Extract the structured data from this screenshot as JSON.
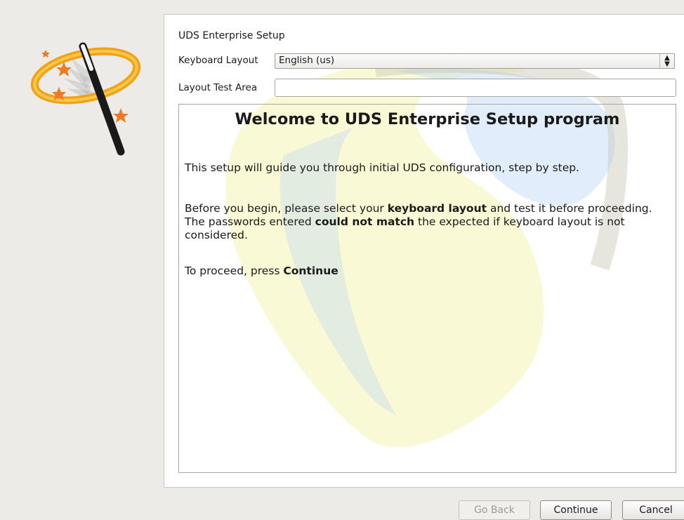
{
  "window": {
    "title": "UDS Enterprise Setup"
  },
  "keyboard": {
    "label": "Keyboard Layout",
    "selected": "English (us)",
    "test_label": "Layout Test Area",
    "test_value": ""
  },
  "welcome": {
    "title": "Welcome to UDS Enterprise Setup program",
    "intro": "This setup will guide you through initial UDS configuration, step by step.",
    "before_1": "Before you begin, please select your ",
    "before_bold_1": "keyboard layout",
    "before_2": " and test it before proceeding. The passwords entered ",
    "before_bold_2": "could not match",
    "before_3": " the expected if keyboard layout is not considered.",
    "proceed_1": "To proceed, press ",
    "proceed_bold": "Continue"
  },
  "buttons": {
    "back": "Go Back",
    "continue": "Continue",
    "cancel": "Cancel"
  },
  "colors": {
    "watermark_yellow": "#f1f19a",
    "watermark_blue": "#bcd8f4",
    "watermark_grey": "#c8c8b8"
  },
  "icons": {
    "logo": "magic-wand-icon",
    "select_arrows": "up-down-arrows-icon"
  }
}
